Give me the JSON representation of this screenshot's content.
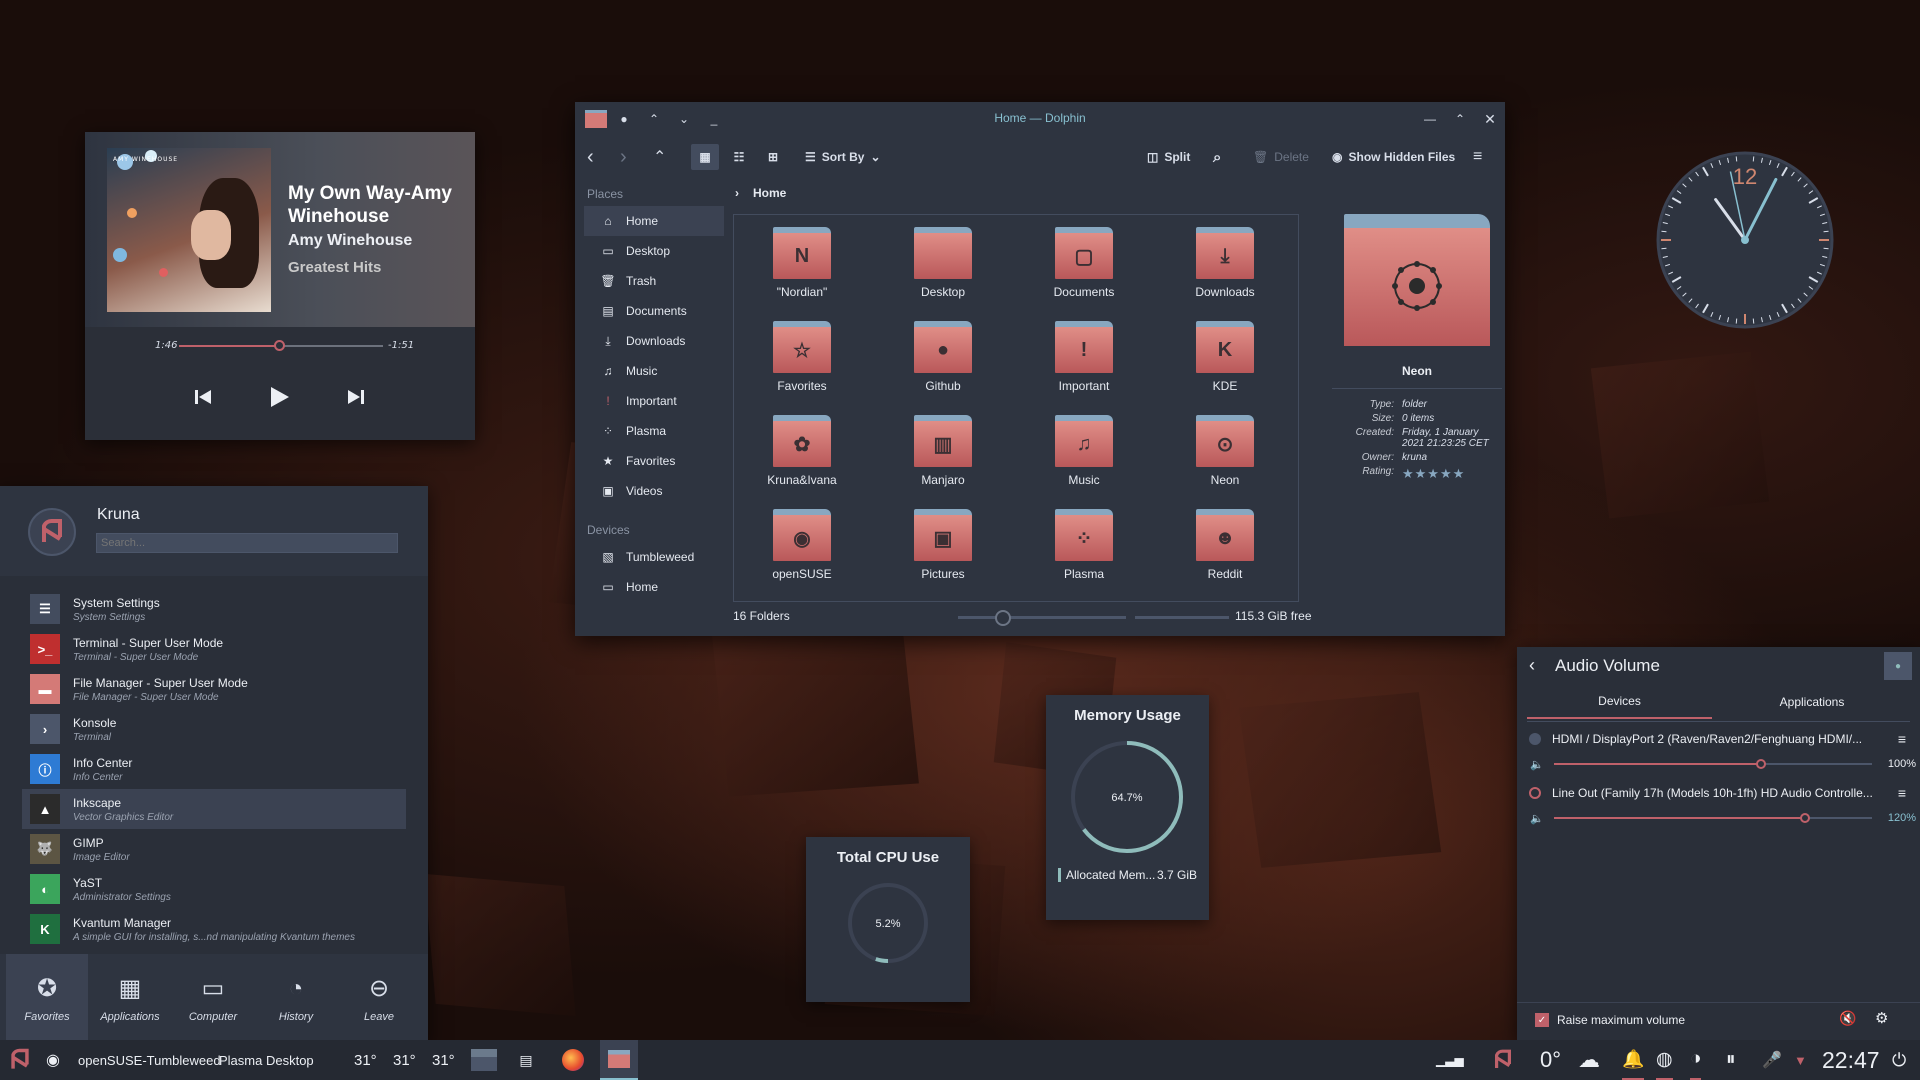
{
  "media": {
    "title": "My Own Way-Amy Winehouse",
    "artist": "Amy Winehouse",
    "album": "Greatest Hits",
    "elapsed": "1:46",
    "remaining": "-1:51",
    "progress": 0.49,
    "cover_text": "AMY WINEHOUSE"
  },
  "dolphin": {
    "title": "Home — Dolphin",
    "toolbar": {
      "sort_by": "Sort By",
      "split": "Split",
      "delete": "Delete",
      "show_hidden": "Show Hidden Files"
    },
    "places_header": "Places",
    "places": [
      "Home",
      "Desktop",
      "Trash",
      "Documents",
      "Downloads",
      "Music",
      "Important",
      "Plasma",
      "Favorites",
      "Videos"
    ],
    "devices_header": "Devices",
    "devices": [
      "Tumbleweed",
      "Home"
    ],
    "breadcrumb": "Home",
    "folders": [
      {
        "name": "\"Nordian\"",
        "glyph": "N"
      },
      {
        "name": "Desktop",
        "glyph": ""
      },
      {
        "name": "Documents",
        "glyph": "▢"
      },
      {
        "name": "Downloads",
        "glyph": "⤓"
      },
      {
        "name": "Favorites",
        "glyph": "☆"
      },
      {
        "name": "Github",
        "glyph": "●"
      },
      {
        "name": "Important",
        "glyph": "!"
      },
      {
        "name": "KDE",
        "glyph": "K"
      },
      {
        "name": "Kruna&Ivana",
        "glyph": "✿"
      },
      {
        "name": "Manjaro",
        "glyph": "▥"
      },
      {
        "name": "Music",
        "glyph": "♫"
      },
      {
        "name": "Neon",
        "glyph": "⊙"
      },
      {
        "name": "openSUSE",
        "glyph": "◉"
      },
      {
        "name": "Pictures",
        "glyph": "▣"
      },
      {
        "name": "Plasma",
        "glyph": "⁘"
      },
      {
        "name": "Reddit",
        "glyph": "☻"
      }
    ],
    "status_left": "16 Folders",
    "status_free": "115.3 GiB free",
    "info": {
      "name": "Neon",
      "type_label": "Type:",
      "type": "folder",
      "size_label": "Size:",
      "size": "0 items",
      "created_label": "Created:",
      "created": "Friday, 1 January 2021 21:23:25 CET",
      "owner_label": "Owner:",
      "owner": "kruna",
      "rating_label": "Rating:",
      "rating": "★★★★★"
    }
  },
  "clock": {
    "label_12": "12",
    "hour": 10.8,
    "minute": 4.5,
    "second": 58
  },
  "launcher": {
    "user": "Kruna",
    "search_placeholder": "Search...",
    "apps": [
      {
        "name": "System Settings",
        "desc": "System Settings"
      },
      {
        "name": "Terminal - Super User Mode",
        "desc": "Terminal - Super User Mode"
      },
      {
        "name": "File Manager - Super User Mode",
        "desc": "File Manager - Super User Mode"
      },
      {
        "name": "Konsole",
        "desc": "Terminal"
      },
      {
        "name": "Info Center",
        "desc": "Info Center"
      },
      {
        "name": "Inkscape",
        "desc": "Vector Graphics Editor"
      },
      {
        "name": "GIMP",
        "desc": "Image Editor"
      },
      {
        "name": "YaST",
        "desc": "Administrator Settings"
      },
      {
        "name": "Kvantum Manager",
        "desc": "A simple GUI for installing, s...nd manipulating Kvantum themes"
      }
    ],
    "tabs": [
      "Favorites",
      "Applications",
      "Computer",
      "History",
      "Leave"
    ]
  },
  "memory": {
    "title": "Memory Usage",
    "percent_label": "64.7%",
    "percent": 64.7,
    "legend": "Allocated Mem...",
    "value": "3.7 GiB"
  },
  "cpu": {
    "title": "Total CPU Use",
    "percent_label": "5.2%",
    "percent": 5.2
  },
  "audio": {
    "title": "Audio Volume",
    "tabs": [
      "Devices",
      "Applications"
    ],
    "devices": [
      {
        "name": "HDMI / DisplayPort 2 (Raven/Raven2/Fenghuang HDMI/...",
        "volume": "100%",
        "level": 0.65
      },
      {
        "name": "Line Out (Family 17h (Models 10h-1fh) HD Audio Controlle...",
        "volume": "120%",
        "level": 0.79
      }
    ],
    "raise_max": "Raise maximum volume"
  },
  "taskbar": {
    "os_label": "openSUSE-Tumbleweed",
    "desktop_label": "Plasma Desktop",
    "temps": [
      "31°",
      "31°",
      "31°"
    ],
    "weather": "0°",
    "time": "22:47"
  },
  "colors": {
    "accent": "#bf616a",
    "bg": "#2e3440",
    "teal": "#88c0d0"
  }
}
